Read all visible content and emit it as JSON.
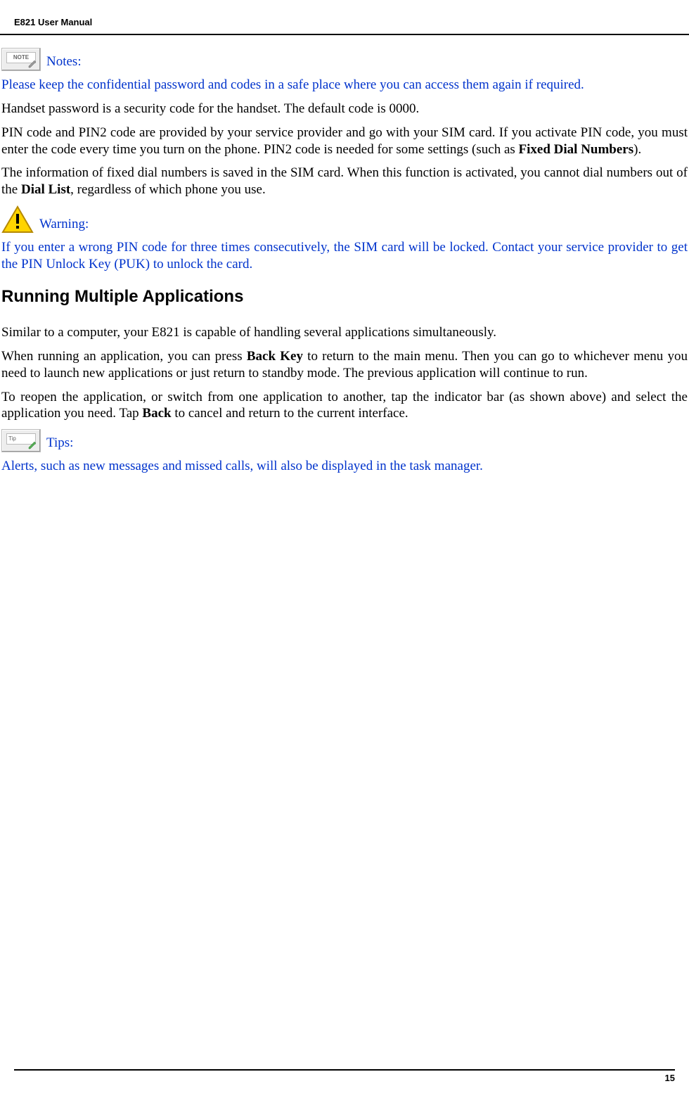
{
  "header": {
    "title": "E821 User Manual"
  },
  "icons": {
    "note_text": "NOTE",
    "tip_text": "Tip"
  },
  "notes": {
    "label": "Notes:",
    "p1": "Please keep the confidential password and codes in a safe place where you can access them again if required.",
    "p2": "Handset password is a security code for the handset. The default code is 0000.",
    "p3_pre": "PIN code and PIN2 code are provided by your service provider and go with your SIM card. If you activate PIN code, you must enter the code every time you turn on the phone. PIN2 code is needed for some settings (such as ",
    "p3_bold": "Fixed Dial Numbers",
    "p3_post": ").",
    "p4_pre": "The information of fixed dial numbers is saved in the SIM card. When this function is activated, you cannot dial numbers out of the ",
    "p4_bold": "Dial List",
    "p4_post": ", regardless of which phone you use."
  },
  "warning": {
    "label": "Warning:",
    "p1": "If you enter a wrong PIN code for three times consecutively, the SIM card will be locked. Contact your service provider to get the PIN Unlock Key (PUK) to unlock the card."
  },
  "section": {
    "heading": "Running Multiple Applications",
    "p1": "Similar to a computer, your E821 is capable of handling several applications simultaneously.",
    "p2_pre": "When running an application, you can press ",
    "p2_bold": "Back Key",
    "p2_post": " to return to the main menu. Then you can go to whichever menu you need to launch new applications or just return to standby mode. The previous application will continue to run.",
    "p3_pre": "To reopen the application, or switch from one application to another, tap the indicator bar (as shown above) and select the application you need. Tap ",
    "p3_bold": "Back",
    "p3_post": " to cancel and return to the current interface."
  },
  "tips": {
    "label": "Tips:",
    "p1": "Alerts, such as new messages and missed calls, will also be displayed in the task manager."
  },
  "footer": {
    "page": "15"
  }
}
